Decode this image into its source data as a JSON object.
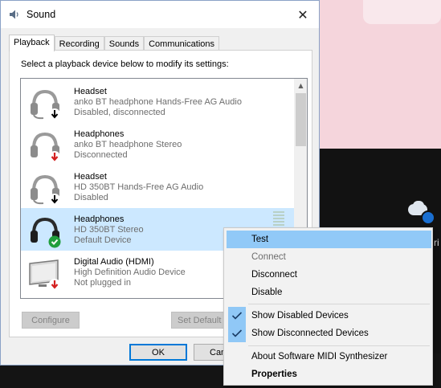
{
  "window": {
    "title": "Sound",
    "close_glyph": "✕"
  },
  "tabs": [
    {
      "label": "Playback",
      "active": true
    },
    {
      "label": "Recording",
      "active": false
    },
    {
      "label": "Sounds",
      "active": false
    },
    {
      "label": "Communications",
      "active": false
    }
  ],
  "instruction": "Select a playback device below to modify its settings:",
  "devices": [
    {
      "name": "Headset",
      "line1": "anko BT headphone Hands-Free AG Audio",
      "line2": "Disabled, disconnected",
      "icon": "headset-icon",
      "badge": "down-arrow-black"
    },
    {
      "name": "Headphones",
      "line1": "anko BT headphone Stereo",
      "line2": "Disconnected",
      "icon": "headphones-icon",
      "badge": "down-arrow-red"
    },
    {
      "name": "Headset",
      "line1": "HD 350BT Hands-Free AG Audio",
      "line2": "Disabled",
      "icon": "headset-icon",
      "badge": "down-arrow-black"
    },
    {
      "name": "Headphones",
      "line1": "HD 350BT Stereo",
      "line2": "Default Device",
      "icon": "headphones-icon",
      "badge": "checkmark-green",
      "selected": true
    },
    {
      "name": "Digital Audio (HDMI)",
      "line1": "High Definition Audio Device",
      "line2": "Not plugged in",
      "icon": "monitor-icon",
      "badge": "down-arrow-red"
    }
  ],
  "buttons": {
    "configure": "Configure",
    "set_default": "Set Default",
    "ok": "OK",
    "cancel": "Can"
  },
  "context_menu": [
    {
      "label": "Test",
      "state": "highlighted"
    },
    {
      "label": "Connect",
      "state": "disabled"
    },
    {
      "label": "Disconnect",
      "state": "normal"
    },
    {
      "label": "Disable",
      "state": "normal"
    },
    {
      "label": "Show Disabled Devices",
      "state": "checked"
    },
    {
      "label": "Show Disconnected Devices",
      "state": "checked"
    },
    {
      "label": "About Software MIDI Synthesizer",
      "state": "normal"
    },
    {
      "label": "Properties",
      "state": "bold"
    }
  ],
  "colors": {
    "selection": "#cce8ff",
    "menu_highlight": "#91c9f7",
    "default_badge": "#1f9e3c",
    "disconnected_badge": "#d42020",
    "accent": "#0078d7"
  }
}
